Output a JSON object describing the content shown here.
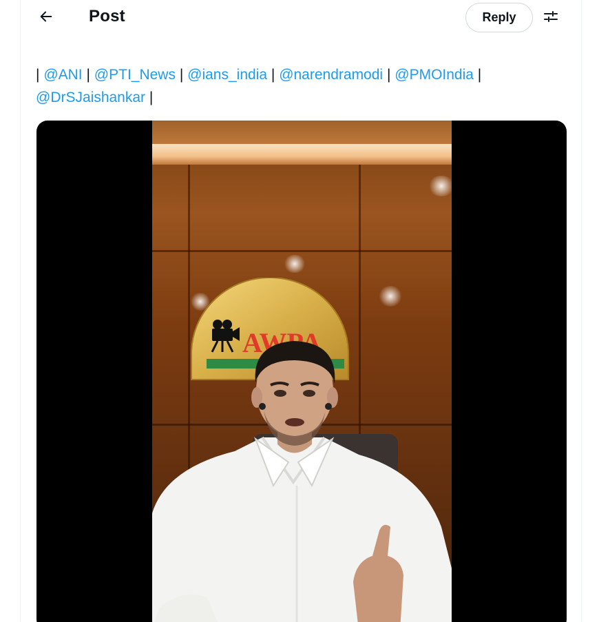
{
  "header": {
    "back_icon": "arrow-left-icon",
    "title": "Post",
    "reply_label": "Reply",
    "filter_icon": "sliders-icon"
  },
  "post": {
    "mentions": [
      "@ANI",
      "@PTI_News",
      "@ians_india",
      "@narendramodi",
      "@PMOIndia",
      "@DrSJaishankar"
    ],
    "separator": "|"
  },
  "media": {
    "type": "video",
    "logo_text": "AWPA",
    "colors": {
      "link": "#1d9bf0",
      "logo_red": "#e23a2a"
    }
  }
}
